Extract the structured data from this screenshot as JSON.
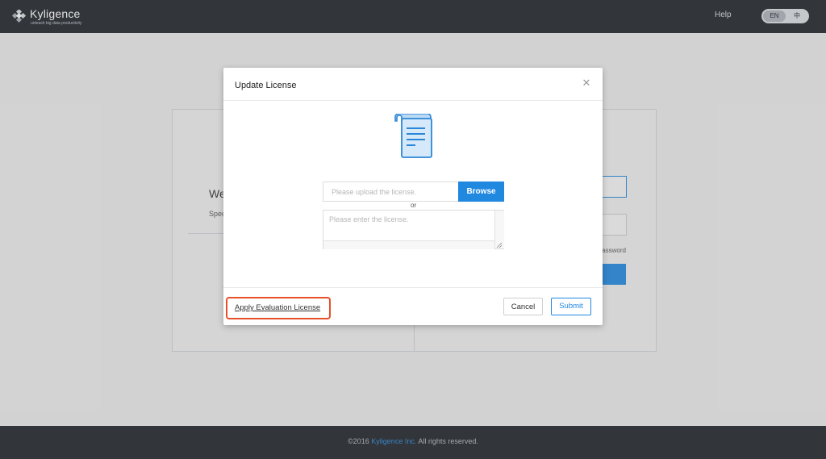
{
  "header": {
    "brand_name": "Kyligence",
    "brand_tagline": "unleash big data productivity",
    "help_label": "Help",
    "lang_en": "EN",
    "lang_zh": "中"
  },
  "background": {
    "welcome_text": "We",
    "spec_text": "Spec",
    "forgot_text": "assword"
  },
  "dialog": {
    "title": "Update License",
    "close_icon": "close-icon",
    "upload_placeholder": "Please upload the license.",
    "browse_label": "Browse",
    "or_text": "or",
    "textarea_placeholder": "Please enter the license.",
    "eval_link": "Apply Evaluation License",
    "cancel_label": "Cancel",
    "submit_label": "Submit"
  },
  "footer": {
    "prefix": "©2016 ",
    "brand": "Kyligence Inc.",
    "suffix": " All rights reserved."
  },
  "colors": {
    "topbar": "#1f2329",
    "primary": "#2188e0",
    "highlight": "#e8502a"
  }
}
